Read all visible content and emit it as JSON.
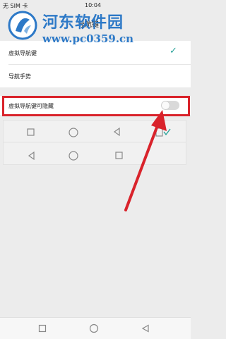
{
  "status_bar": {
    "carrier": "无 SIM 卡",
    "time": "10:04"
  },
  "app_bar": {
    "title": "导航键"
  },
  "watermark": {
    "title": "河东软件园",
    "url": "www.pc0359.cn"
  },
  "options": [
    {
      "label": "虚拟导航键",
      "selected": true
    },
    {
      "label": "导航手势",
      "selected": false
    }
  ],
  "hide_setting": {
    "label": "虚拟导航键可隐藏",
    "enabled": false
  },
  "colors": {
    "accent": "#2aa39a",
    "highlight": "#d9232b",
    "arrow": "#d9232b",
    "watermark": "#2d79c7"
  },
  "icons": {
    "preview_top": [
      "square-icon",
      "circle-icon",
      "back-triangle-icon",
      "notification-tray-icon"
    ],
    "preview_bottom": [
      "back-triangle-icon",
      "circle-icon",
      "square-icon"
    ],
    "navbar": [
      "square-icon",
      "circle-icon",
      "back-triangle-icon"
    ]
  }
}
